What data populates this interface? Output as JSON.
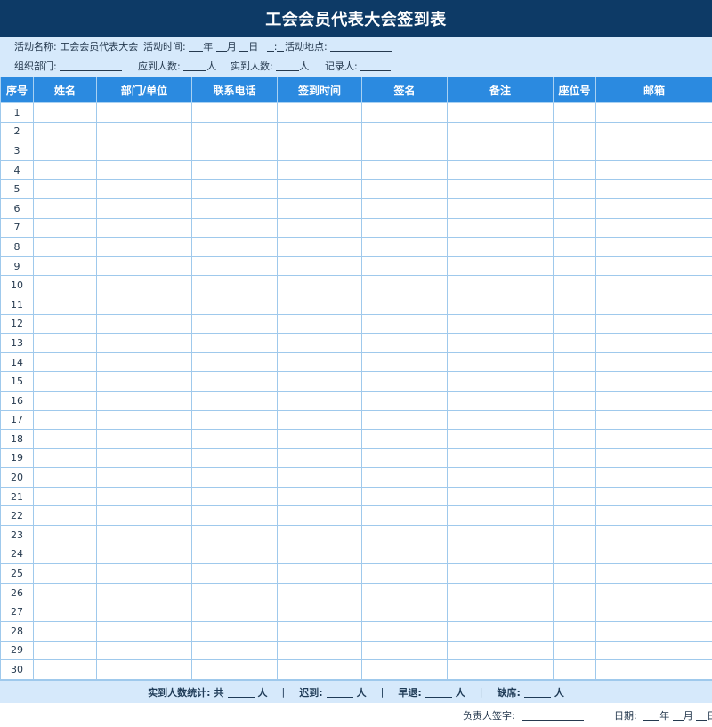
{
  "title": "工会会员代表大会签到表",
  "info": {
    "activity_name_label": "活动名称:",
    "activity_name_value": "工会会员代表大会",
    "activity_time_label": "活动时间:",
    "time_year": "年",
    "time_month": "月",
    "time_day": "日",
    "time_colon": ":",
    "location_label": "活动地点:",
    "org_dept_label": "组织部门:",
    "expected_label": "应到人数:",
    "actual_label": "实到人数:",
    "person_unit": "人",
    "recorder_label": "记录人:"
  },
  "columns": [
    "序号",
    "姓名",
    "部门/单位",
    "联系电话",
    "签到时间",
    "签名",
    "备注",
    "座位号",
    "邮箱"
  ],
  "rows": [
    "1",
    "2",
    "3",
    "4",
    "5",
    "6",
    "7",
    "8",
    "9",
    "10",
    "11",
    "12",
    "13",
    "14",
    "15",
    "16",
    "17",
    "18",
    "19",
    "20",
    "21",
    "22",
    "23",
    "24",
    "25",
    "26",
    "27",
    "28",
    "29",
    "30"
  ],
  "summary": {
    "label": "实到人数统计:",
    "total_prefix": "共",
    "late_label": "迟到:",
    "early_label": "早退:",
    "absent_label": "缺席:",
    "person_unit": "人",
    "separator": "|"
  },
  "footer": {
    "signer_label": "负责人签字:",
    "date_label": "日期:",
    "year": "年",
    "month": "月",
    "day": "日"
  },
  "colors": {
    "title_bg": "#0d3a66",
    "info_bg": "#d6e9fb",
    "header_bg": "#2b8ae0",
    "grid_line": "#9fc9ec"
  }
}
